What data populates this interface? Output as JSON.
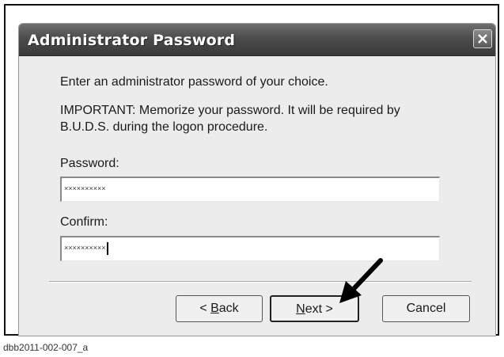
{
  "dialog": {
    "title": "Administrator Password",
    "intro": "Enter an administrator password of your choice.",
    "important": "IMPORTANT: Memorize your password. It will be required by B.U.D.S. during the logon procedure.",
    "password_label": "Password:",
    "password_value": "××××××××××",
    "confirm_label": "Confirm:",
    "confirm_value": "××××××××××"
  },
  "buttons": {
    "back_prefix": "< ",
    "back_accel": "B",
    "back_rest": "ack",
    "next_accel": "N",
    "next_rest": "ext >",
    "cancel": "Cancel"
  },
  "caption": "dbb2011-002-007_a",
  "icons": {
    "close": "close-icon",
    "pointer": "pointer-arrow-icon"
  }
}
